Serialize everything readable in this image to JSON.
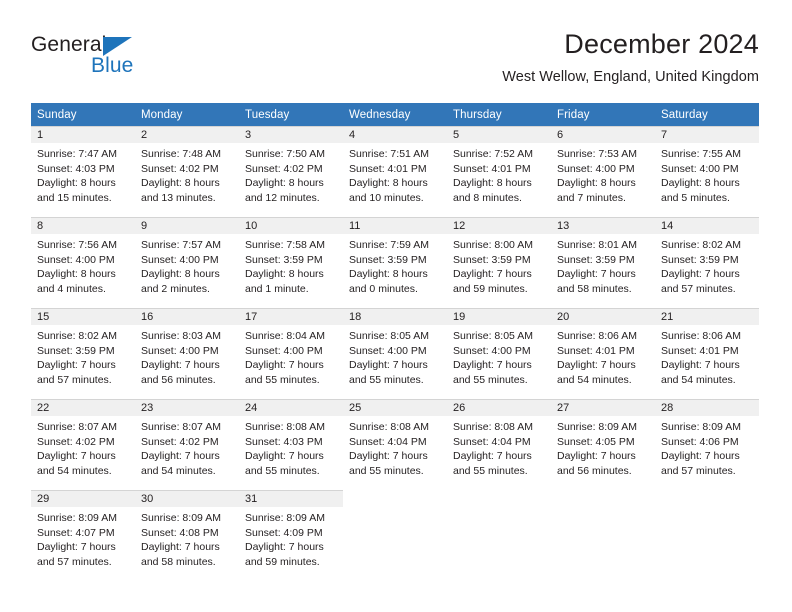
{
  "brand": {
    "name_part1": "General",
    "name_part2": "Blue",
    "colors": {
      "blue": "#1e74bb",
      "header_blue": "#3276b8",
      "band_gray": "#f0f0f0",
      "text": "#231f20"
    }
  },
  "header": {
    "title": "December 2024",
    "subtitle": "West Wellow, England, United Kingdom"
  },
  "calendar": {
    "weekday_headers": [
      "Sunday",
      "Monday",
      "Tuesday",
      "Wednesday",
      "Thursday",
      "Friday",
      "Saturday"
    ],
    "weeks": [
      [
        {
          "day": "1",
          "info": "Sunrise: 7:47 AM\nSunset: 4:03 PM\nDaylight: 8 hours\nand 15 minutes."
        },
        {
          "day": "2",
          "info": "Sunrise: 7:48 AM\nSunset: 4:02 PM\nDaylight: 8 hours\nand 13 minutes."
        },
        {
          "day": "3",
          "info": "Sunrise: 7:50 AM\nSunset: 4:02 PM\nDaylight: 8 hours\nand 12 minutes."
        },
        {
          "day": "4",
          "info": "Sunrise: 7:51 AM\nSunset: 4:01 PM\nDaylight: 8 hours\nand 10 minutes."
        },
        {
          "day": "5",
          "info": "Sunrise: 7:52 AM\nSunset: 4:01 PM\nDaylight: 8 hours\nand 8 minutes."
        },
        {
          "day": "6",
          "info": "Sunrise: 7:53 AM\nSunset: 4:00 PM\nDaylight: 8 hours\nand 7 minutes."
        },
        {
          "day": "7",
          "info": "Sunrise: 7:55 AM\nSunset: 4:00 PM\nDaylight: 8 hours\nand 5 minutes."
        }
      ],
      [
        {
          "day": "8",
          "info": "Sunrise: 7:56 AM\nSunset: 4:00 PM\nDaylight: 8 hours\nand 4 minutes."
        },
        {
          "day": "9",
          "info": "Sunrise: 7:57 AM\nSunset: 4:00 PM\nDaylight: 8 hours\nand 2 minutes."
        },
        {
          "day": "10",
          "info": "Sunrise: 7:58 AM\nSunset: 3:59 PM\nDaylight: 8 hours\nand 1 minute."
        },
        {
          "day": "11",
          "info": "Sunrise: 7:59 AM\nSunset: 3:59 PM\nDaylight: 8 hours\nand 0 minutes."
        },
        {
          "day": "12",
          "info": "Sunrise: 8:00 AM\nSunset: 3:59 PM\nDaylight: 7 hours\nand 59 minutes."
        },
        {
          "day": "13",
          "info": "Sunrise: 8:01 AM\nSunset: 3:59 PM\nDaylight: 7 hours\nand 58 minutes."
        },
        {
          "day": "14",
          "info": "Sunrise: 8:02 AM\nSunset: 3:59 PM\nDaylight: 7 hours\nand 57 minutes."
        }
      ],
      [
        {
          "day": "15",
          "info": "Sunrise: 8:02 AM\nSunset: 3:59 PM\nDaylight: 7 hours\nand 57 minutes."
        },
        {
          "day": "16",
          "info": "Sunrise: 8:03 AM\nSunset: 4:00 PM\nDaylight: 7 hours\nand 56 minutes."
        },
        {
          "day": "17",
          "info": "Sunrise: 8:04 AM\nSunset: 4:00 PM\nDaylight: 7 hours\nand 55 minutes."
        },
        {
          "day": "18",
          "info": "Sunrise: 8:05 AM\nSunset: 4:00 PM\nDaylight: 7 hours\nand 55 minutes."
        },
        {
          "day": "19",
          "info": "Sunrise: 8:05 AM\nSunset: 4:00 PM\nDaylight: 7 hours\nand 55 minutes."
        },
        {
          "day": "20",
          "info": "Sunrise: 8:06 AM\nSunset: 4:01 PM\nDaylight: 7 hours\nand 54 minutes."
        },
        {
          "day": "21",
          "info": "Sunrise: 8:06 AM\nSunset: 4:01 PM\nDaylight: 7 hours\nand 54 minutes."
        }
      ],
      [
        {
          "day": "22",
          "info": "Sunrise: 8:07 AM\nSunset: 4:02 PM\nDaylight: 7 hours\nand 54 minutes."
        },
        {
          "day": "23",
          "info": "Sunrise: 8:07 AM\nSunset: 4:02 PM\nDaylight: 7 hours\nand 54 minutes."
        },
        {
          "day": "24",
          "info": "Sunrise: 8:08 AM\nSunset: 4:03 PM\nDaylight: 7 hours\nand 55 minutes."
        },
        {
          "day": "25",
          "info": "Sunrise: 8:08 AM\nSunset: 4:04 PM\nDaylight: 7 hours\nand 55 minutes."
        },
        {
          "day": "26",
          "info": "Sunrise: 8:08 AM\nSunset: 4:04 PM\nDaylight: 7 hours\nand 55 minutes."
        },
        {
          "day": "27",
          "info": "Sunrise: 8:09 AM\nSunset: 4:05 PM\nDaylight: 7 hours\nand 56 minutes."
        },
        {
          "day": "28",
          "info": "Sunrise: 8:09 AM\nSunset: 4:06 PM\nDaylight: 7 hours\nand 57 minutes."
        }
      ],
      [
        {
          "day": "29",
          "info": "Sunrise: 8:09 AM\nSunset: 4:07 PM\nDaylight: 7 hours\nand 57 minutes."
        },
        {
          "day": "30",
          "info": "Sunrise: 8:09 AM\nSunset: 4:08 PM\nDaylight: 7 hours\nand 58 minutes."
        },
        {
          "day": "31",
          "info": "Sunrise: 8:09 AM\nSunset: 4:09 PM\nDaylight: 7 hours\nand 59 minutes."
        },
        {
          "day": "",
          "info": ""
        },
        {
          "day": "",
          "info": ""
        },
        {
          "day": "",
          "info": ""
        },
        {
          "day": "",
          "info": ""
        }
      ]
    ]
  }
}
